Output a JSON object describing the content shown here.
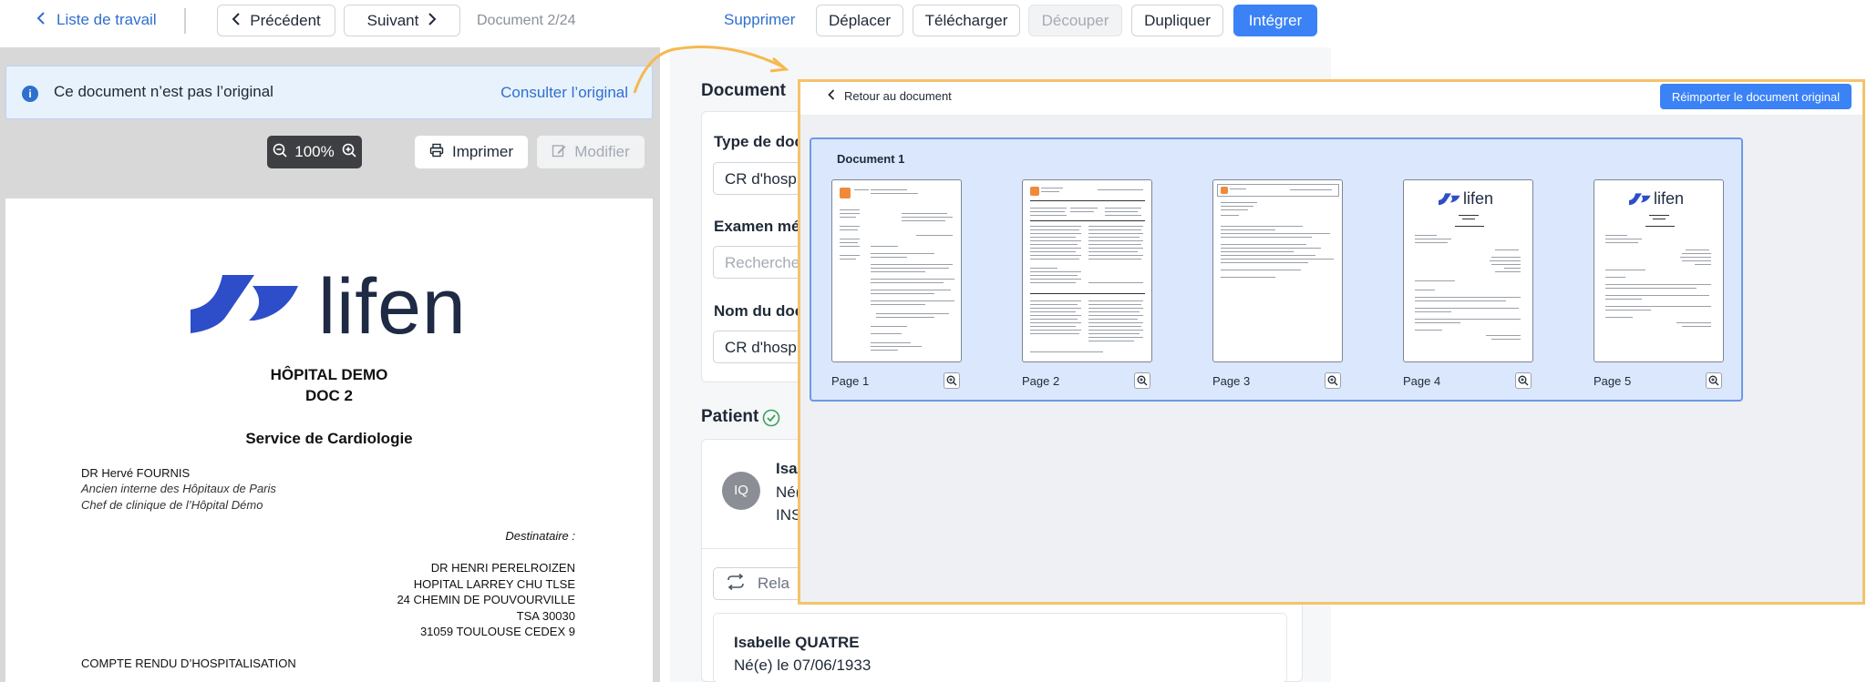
{
  "topbar": {
    "back_label": "Liste de travail",
    "prev_label": "Précédent",
    "next_label": "Suivant",
    "doc_counter": "Document 2/24",
    "delete_label": "Supprimer",
    "move_label": "Déplacer",
    "download_label": "Télécharger",
    "split_label": "Découper",
    "duplicate_label": "Dupliquer",
    "integrate_label": "Intégrer"
  },
  "banner": {
    "message": "Ce document n’est pas l’original",
    "link": "Consulter l’original"
  },
  "viewer": {
    "zoom": "100%",
    "print_label": "Imprimer",
    "edit_label": "Modifier"
  },
  "paper": {
    "logo_text": "lifen",
    "hospital": "HÔPITAL DEMO",
    "doc": "DOC 2",
    "service": "Service de Cardiologie",
    "doctor_name": "DR Hervé FOURNIS",
    "doctor_title1": "Ancien interne des Hôpitaux de Paris",
    "doctor_title2": "Chef de clinique de l’Hôpital Démo",
    "recipient_label": "Destinataire :",
    "recipient_lines": [
      "DR HENRI PERELROIZEN",
      "HOPITAL LARREY CHU TLSE",
      "24 CHEMIN DE POUVOURVILLE",
      "TSA 30030",
      "31059 TOULOUSE CEDEX 9"
    ],
    "report_title": "COMPTE RENDU D’HOSPITALISATION"
  },
  "form": {
    "document_title": "Document",
    "type_label": "Type de doc",
    "type_value": "CR d'hosp",
    "exam_label": "Examen mé",
    "exam_placeholder": "Recherche",
    "name_label": "Nom du doc",
    "name_value": "CR d'hosp",
    "patient_title": "Patient",
    "patient_initials": "IQ",
    "patient_short_name": "Isa",
    "patient_short_birth": "Né(",
    "patient_short_ins": "INS",
    "relink_label": "Rela",
    "patient_name": "Isabelle QUATRE",
    "patient_birth": "Né(e) le 07/06/1933"
  },
  "overlay": {
    "back_label": "Retour au document",
    "reimport_label": "Réimporter le document original",
    "group_title": "Document 1",
    "pages": [
      {
        "label": "Page 1",
        "kind": "letter"
      },
      {
        "label": "Page 2",
        "kind": "table"
      },
      {
        "label": "Page 3",
        "kind": "report"
      },
      {
        "label": "Page 4",
        "kind": "lifen"
      },
      {
        "label": "Page 5",
        "kind": "lifen"
      }
    ],
    "thumb_logo_text": "lifen"
  },
  "colors": {
    "accent": "#3b82f6",
    "link": "#2f6fce",
    "highlight_border": "#f5c26b",
    "logo_blue": "#2d4ec8",
    "group_bg": "#dbe7fd"
  }
}
